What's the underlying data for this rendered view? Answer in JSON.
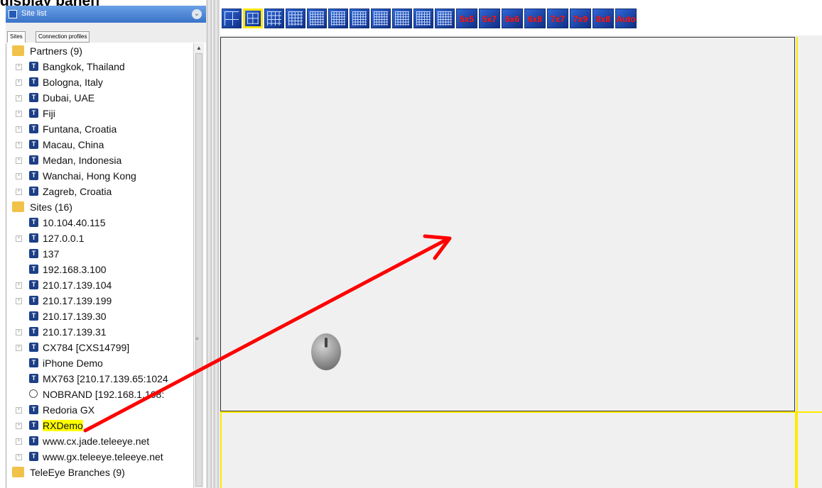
{
  "heading": "display panel]",
  "panel": {
    "title": "Site list",
    "tabs": [
      "Sites",
      "Connection profiles"
    ]
  },
  "tree": [
    {
      "type": "folder",
      "label": "Partners (9)"
    },
    {
      "type": "item",
      "label": "Bangkok, Thailand",
      "expand": true
    },
    {
      "type": "item",
      "label": "Bologna, Italy",
      "expand": true
    },
    {
      "type": "item",
      "label": "Dubai, UAE",
      "expand": true
    },
    {
      "type": "item",
      "label": "Fiji",
      "expand": true
    },
    {
      "type": "item",
      "label": "Funtana, Croatia",
      "expand": true
    },
    {
      "type": "item",
      "label": "Macau, China",
      "expand": true
    },
    {
      "type": "item",
      "label": "Medan, Indonesia",
      "expand": true
    },
    {
      "type": "item",
      "label": "Wanchai, Hong Kong",
      "expand": true
    },
    {
      "type": "item",
      "label": "Zagreb, Croatia",
      "expand": true
    },
    {
      "type": "folder",
      "label": "Sites (16)"
    },
    {
      "type": "item",
      "label": "10.104.40.115",
      "expand": false
    },
    {
      "type": "item",
      "label": "127.0.0.1",
      "expand": true
    },
    {
      "type": "item",
      "label": "137",
      "expand": false
    },
    {
      "type": "item",
      "label": "192.168.3.100",
      "expand": false
    },
    {
      "type": "item",
      "label": "210.17.139.104",
      "expand": true
    },
    {
      "type": "item",
      "label": "210.17.139.199",
      "expand": true
    },
    {
      "type": "item",
      "label": "210.17.139.30",
      "expand": false
    },
    {
      "type": "item",
      "label": "210.17.139.31",
      "expand": true
    },
    {
      "type": "item",
      "label": "CX784 [CXS14799]",
      "expand": true
    },
    {
      "type": "item",
      "label": "iPhone Demo",
      "expand": false
    },
    {
      "type": "item",
      "label": "MX763 [210.17.139.65:1024",
      "expand": false
    },
    {
      "type": "circle",
      "label": "NOBRAND [192.168.1.168:",
      "expand": false
    },
    {
      "type": "item",
      "label": "Redoria GX",
      "expand": true
    },
    {
      "type": "item",
      "label": "RXDemo",
      "expand": true,
      "highlight": true
    },
    {
      "type": "item",
      "label": "www.cx.jade.teleeye.net",
      "expand": true
    },
    {
      "type": "item",
      "label": "www.gx.teleeye.teleeye.net",
      "expand": true
    },
    {
      "type": "folder",
      "label": "TeleEye Branches (9)"
    }
  ],
  "toolbar": {
    "grid_buttons": [
      1,
      2,
      3,
      4,
      5,
      6,
      7,
      8,
      9,
      10,
      11
    ],
    "selected_index": 1,
    "text_buttons": [
      "5x5",
      "5x7",
      "6x6",
      "6x8",
      "7x7",
      "7x9",
      "8x8",
      "Auto"
    ]
  },
  "colors": {
    "accent": "#ffea00",
    "arrow": "#ff0000",
    "button": "#1f4fb8",
    "folder": "#f1c24a"
  }
}
